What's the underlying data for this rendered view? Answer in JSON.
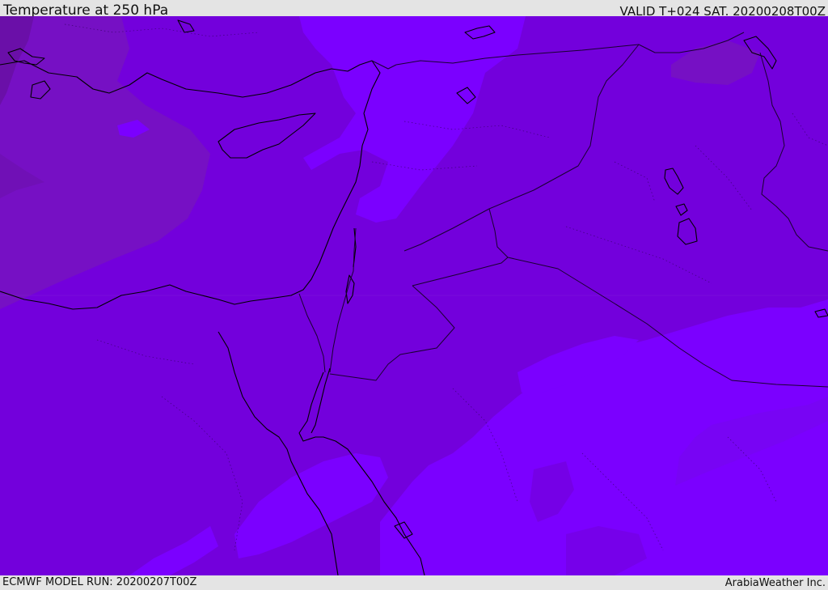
{
  "header": {
    "title": "Temperature at 250 hPa",
    "valid": "VALID T+024 SAT. 20200208T00Z"
  },
  "footer": {
    "model_run": "ECMWF MODEL RUN: 20200207T00Z",
    "credit": "ArabiaWeather Inc."
  },
  "map": {
    "field": "Temperature at 250 hPa",
    "region": "Eastern Mediterranean and Middle East",
    "colors": {
      "base_field": "#7300dc",
      "warm_zone": "#7b00ff",
      "warm_zone_edge": "#7606ec",
      "cold_zone": "#7610c4",
      "coldest_zone": "#6a0fa8",
      "coastline": "#000000",
      "border": "#1a0030"
    }
  }
}
